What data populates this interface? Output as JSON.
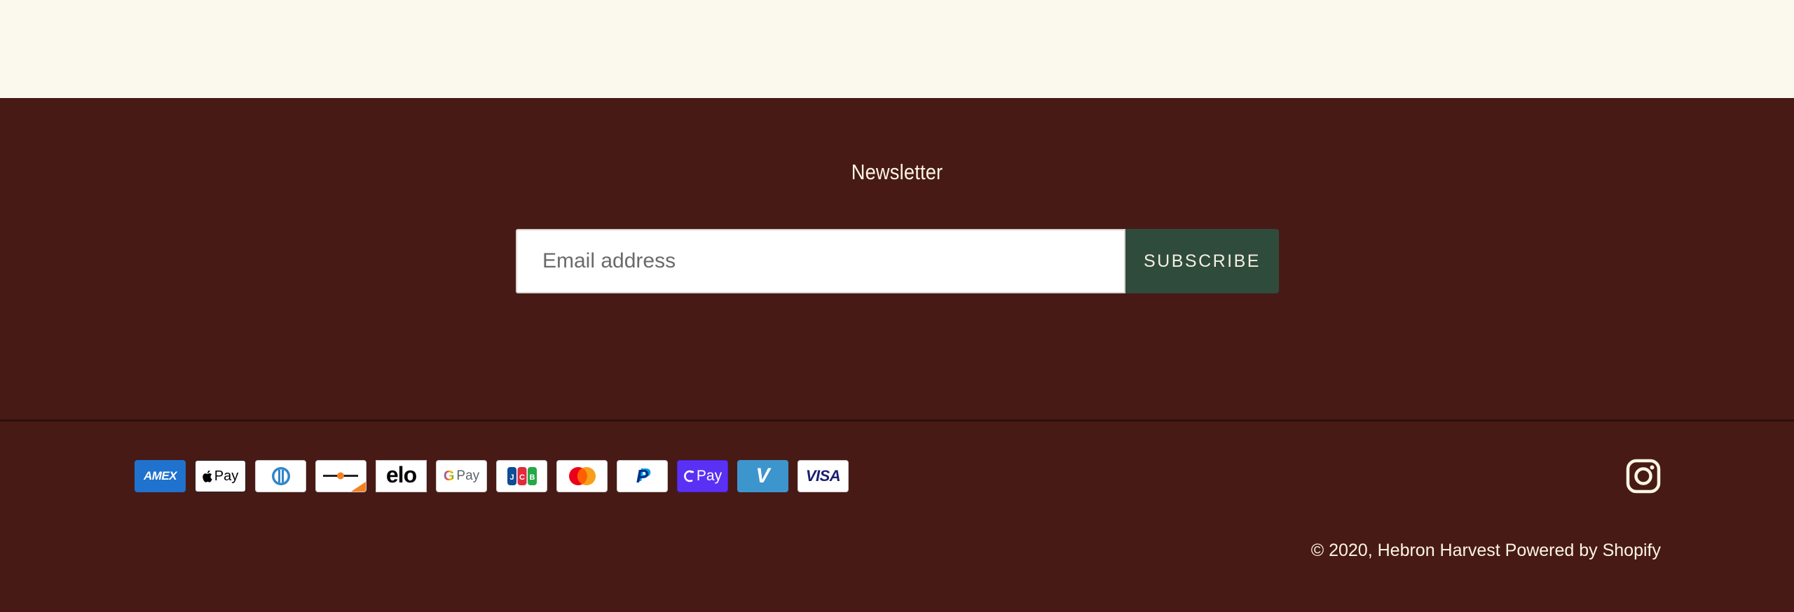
{
  "newsletter": {
    "title": "Newsletter",
    "email_placeholder": "Email address",
    "email_value": "",
    "subscribe_label": "SUBSCRIBE"
  },
  "payment_methods": [
    {
      "name": "American Express",
      "label": "AMEX",
      "icon": "amex-icon",
      "bg": "#1f72cd"
    },
    {
      "name": "Apple Pay",
      "label": "Pay",
      "icon": "apple-pay-icon",
      "bg": "#ffffff"
    },
    {
      "name": "Diners Club",
      "label": "",
      "icon": "diners-club-icon",
      "bg": "#ffffff"
    },
    {
      "name": "Discover",
      "label": "",
      "icon": "discover-icon",
      "bg": "#ffffff"
    },
    {
      "name": "Elo",
      "label": "elo",
      "icon": "elo-icon",
      "bg": "#ffffff"
    },
    {
      "name": "Google Pay",
      "label": "Pay",
      "icon": "google-pay-icon",
      "bg": "#ffffff"
    },
    {
      "name": "JCB",
      "label": "JCB",
      "icon": "jcb-icon",
      "bg": "#ffffff"
    },
    {
      "name": "Mastercard",
      "label": "",
      "icon": "mastercard-icon",
      "bg": "#ffffff"
    },
    {
      "name": "PayPal",
      "label": "P",
      "icon": "paypal-icon",
      "bg": "#ffffff"
    },
    {
      "name": "Shop Pay",
      "label": "Pay",
      "icon": "shop-pay-icon",
      "bg": "#5a31f4"
    },
    {
      "name": "Venmo",
      "label": "V",
      "icon": "venmo-icon",
      "bg": "#3d95ce"
    },
    {
      "name": "Visa",
      "label": "VISA",
      "icon": "visa-icon",
      "bg": "#ffffff"
    }
  ],
  "social": {
    "instagram_icon": "instagram-icon"
  },
  "footer": {
    "copyright_prefix": "© 2020,",
    "store_name": "Hebron Harvest",
    "powered_by": "Powered by Shopify"
  },
  "colors": {
    "top_band": "#fbf9ee",
    "footer_bg": "#481a16",
    "button_bg": "#2f4b3c",
    "text_light": "#fbf6e4"
  }
}
